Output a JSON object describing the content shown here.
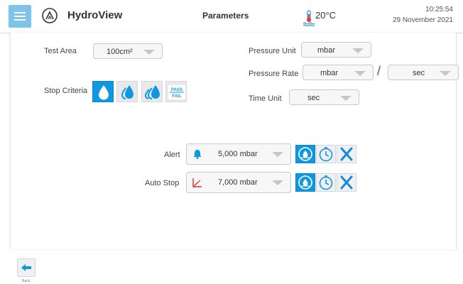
{
  "app": {
    "title": "HydroView"
  },
  "header": {
    "page_title": "Parameters",
    "temperature": "20°C",
    "time": "10:25:54",
    "date": "29 November 2021"
  },
  "test_area": {
    "label": "Test Area",
    "value": "100cm²"
  },
  "stop_criteria": {
    "label": "Stop Criteria",
    "options": [
      "drop-icon",
      "double-drop-icon",
      "triple-drop-icon",
      "pass-fail-icon"
    ],
    "pass_fail_top": "PASS",
    "pass_fail_bottom": "FAIL",
    "selected_index": 0
  },
  "pressure_unit": {
    "label": "Pressure Unit",
    "value": "mbar"
  },
  "pressure_rate": {
    "label": "Pressure Rate",
    "value": "mbar",
    "separator": "/",
    "per_value": "sec"
  },
  "time_unit": {
    "label": "Time Unit",
    "value": "sec"
  },
  "alert": {
    "label": "Alert",
    "value": "5,000 mbar",
    "icon": "bell-icon"
  },
  "auto_stop": {
    "label": "Auto Stop",
    "value": "7,000 mbar",
    "icon": "chart-icon"
  },
  "footer": {
    "back_label": "Back"
  },
  "colors": {
    "accent": "#0f97e0",
    "menu": "#7ec3ea",
    "close": "#1a8ad4",
    "chart_red": "#d9342b"
  }
}
